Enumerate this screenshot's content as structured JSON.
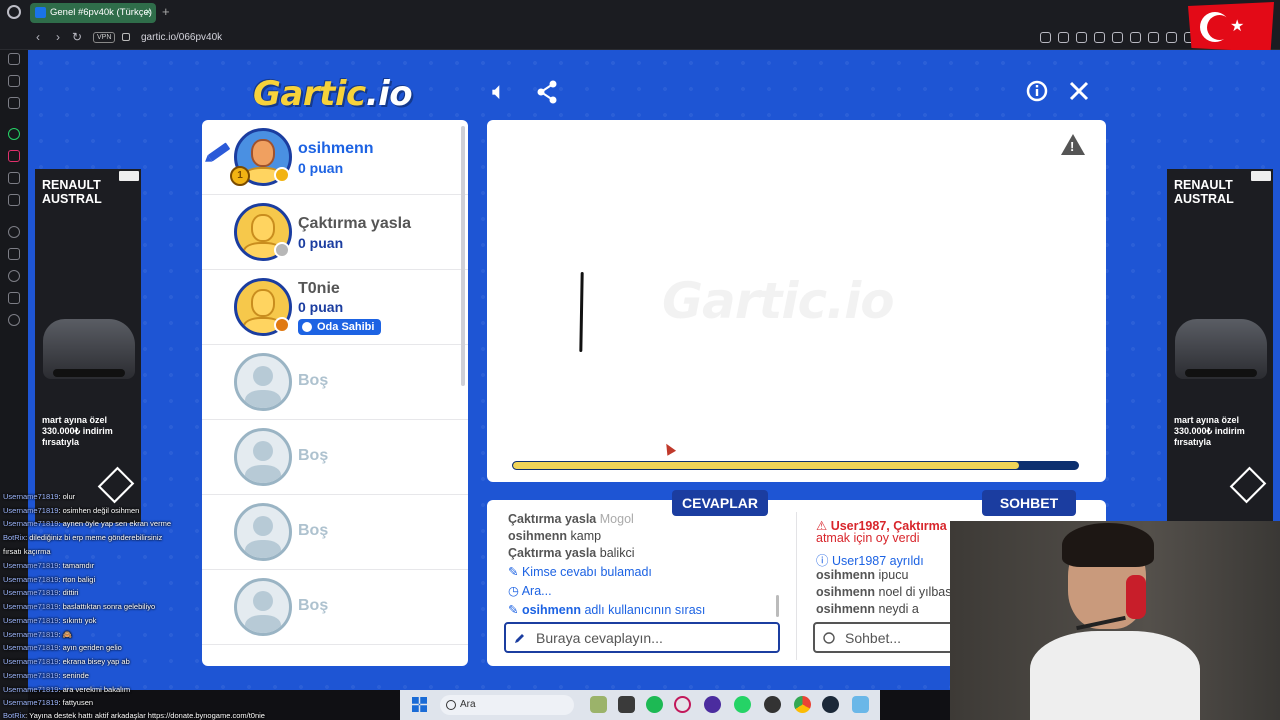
{
  "browser": {
    "tab_title": "Genel #6pv40k (Türkçe)",
    "tab_close": "×",
    "new_tab": "+",
    "vpn": "VPN",
    "url": "gartic.io/066pv40k"
  },
  "game": {
    "logo_main": "Gartic",
    "logo_io": ".io",
    "watermark": "Gartic.io",
    "progress_fraction": 0.895
  },
  "players": [
    {
      "name": "osihmenn",
      "score": "0 puan",
      "drawing": true,
      "status_color": "#f2b313",
      "trophy": "1"
    },
    {
      "name": "Çaktırma yasla",
      "score": "0 puan",
      "status_color": "#b7b7b7"
    },
    {
      "name": "T0nie",
      "score": "0 puan",
      "status_color": "#e07a12",
      "badge": "Oda Sahibi"
    },
    {
      "name": "Boş"
    },
    {
      "name": "Boş"
    },
    {
      "name": "Boş"
    },
    {
      "name": "Boş"
    }
  ],
  "answers": {
    "tab_label": "CEVAPLAR",
    "placeholder": "Buraya cevaplayın...",
    "lines": [
      {
        "user": "Çaktırma yasla",
        "text": "Mogol"
      },
      {
        "user": "osihmenn",
        "text": "kamp"
      },
      {
        "user": "Çaktırma yasla",
        "text": "balikci"
      },
      {
        "text": "Kimse cevabı bulamadı"
      },
      {
        "text": "Ara..."
      },
      {
        "user": "osihmenn",
        "text": "adlı kullanıcının sırası"
      }
    ]
  },
  "chat": {
    "tab_label": "SOHBET",
    "placeholder": "Sohbet...",
    "lines": [
      {
        "text": "User1987, Çaktırma",
        "text2": "atmak için oy verdi"
      },
      {
        "text": "User1987 ayrıldı"
      },
      {
        "user": "osihmenn",
        "text": "ipucu"
      },
      {
        "user": "osihmenn",
        "text": "noel di yılbas"
      },
      {
        "user": "osihmenn",
        "text": "neydi a"
      }
    ]
  },
  "ad": {
    "title": "RENAULT AUSTRAL",
    "text": "mart ayına özel 330.000₺ indirim fırsatıyla"
  },
  "stream_chat": [
    {
      "u": "Username71819",
      "m": ": olur"
    },
    {
      "u": "Username71819",
      "m": ": osimhen değil osihmen"
    },
    {
      "u": "Username71819",
      "m": ": aynen öyle yap sen ekran verme"
    },
    {
      "u": "BotRix",
      "m": ": dilediğiniz bi erp meme gönderebilirsiniz"
    },
    {
      "u": "",
      "m": "fırsatı kaçırma"
    },
    {
      "u": "Username71819",
      "m": ": tamamdır"
    },
    {
      "u": "Username71819",
      "m": ": rton baligi"
    },
    {
      "u": "Username71819",
      "m": ": dittiri"
    },
    {
      "u": "Username71819",
      "m": ": baslattıktan sonra gelebiliyo"
    },
    {
      "u": "Username71819",
      "m": ": sıkıntı yok"
    },
    {
      "u": "Username71819",
      "m": ": 🙈"
    },
    {
      "u": "Username71819",
      "m": ": ayın geriden gelio"
    },
    {
      "u": "Username71819",
      "m": ": ekrana bisey yap ab"
    },
    {
      "u": "Username71819",
      "m": ": seninde"
    },
    {
      "u": "Username71819",
      "m": ": ara verekmi bakalım"
    },
    {
      "u": "Username71819",
      "m": ": fattyusen"
    },
    {
      "u": "BotRix",
      "m": ": Yayına destek hattı aktif arkadaşlar https://donate.bynogame.com/t0nie"
    }
  ],
  "taskbar": {
    "search": "Ara"
  }
}
